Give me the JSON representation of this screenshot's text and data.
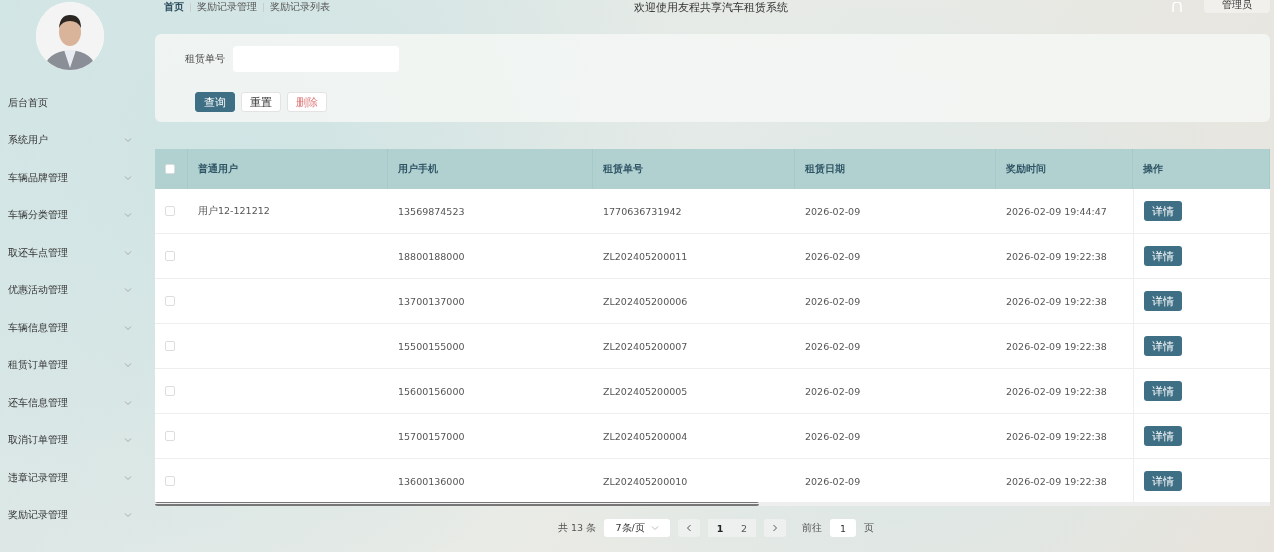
{
  "breadcrumb": [
    {
      "label": "首页",
      "selected": true
    },
    {
      "label": "奖励记录管理",
      "selected": false
    },
    {
      "label": "奖励记录列表",
      "selected": false
    }
  ],
  "header": {
    "title": "欢迎使用友程共享汽车租赁系统",
    "user_button": "管理员"
  },
  "sidebar": {
    "items": [
      {
        "label": "后台首页",
        "expandable": false
      },
      {
        "label": "系统用户",
        "expandable": true
      },
      {
        "label": "车辆品牌管理",
        "expandable": true
      },
      {
        "label": "车辆分类管理",
        "expandable": true
      },
      {
        "label": "取还车点管理",
        "expandable": true
      },
      {
        "label": "优惠活动管理",
        "expandable": true
      },
      {
        "label": "车辆信息管理",
        "expandable": true
      },
      {
        "label": "租赁订单管理",
        "expandable": true
      },
      {
        "label": "还车信息管理",
        "expandable": true
      },
      {
        "label": "取消订单管理",
        "expandable": true
      },
      {
        "label": "违章记录管理",
        "expandable": true
      },
      {
        "label": "奖励记录管理",
        "expandable": true
      }
    ]
  },
  "search": {
    "label": "租赁单号",
    "buttons": [
      {
        "label": "查询",
        "kind": "primary"
      },
      {
        "label": "重置",
        "kind": "default"
      },
      {
        "label": "删除",
        "kind": "danger"
      }
    ]
  },
  "table": {
    "select_all": {
      "checked": false
    },
    "columns": [
      "普通用户",
      "用户手机",
      "租赁单号",
      "租赁日期",
      "奖励时间",
      "操作"
    ],
    "rows": [
      {
        "checked": false,
        "cells": [
          "用户12-121212",
          "13569874523",
          "1770636731942",
          "2026-02-09",
          "2026-02-09 19:44:47"
        ],
        "action": "详情"
      },
      {
        "checked": false,
        "cells": [
          "",
          "18800188000",
          "ZL202405200011",
          "2026-02-09",
          "2026-02-09 19:22:38"
        ],
        "action": "详情"
      },
      {
        "checked": false,
        "cells": [
          "",
          "13700137000",
          "ZL202405200006",
          "2026-02-09",
          "2026-02-09 19:22:38"
        ],
        "action": "详情"
      },
      {
        "checked": false,
        "cells": [
          "",
          "15500155000",
          "ZL202405200007",
          "2026-02-09",
          "2026-02-09 19:22:38"
        ],
        "action": "详情"
      },
      {
        "checked": false,
        "cells": [
          "",
          "15600156000",
          "ZL202405200005",
          "2026-02-09",
          "2026-02-09 19:22:38"
        ],
        "action": "详情"
      },
      {
        "checked": false,
        "cells": [
          "",
          "15700157000",
          "ZL202405200004",
          "2026-02-09",
          "2026-02-09 19:22:38"
        ],
        "action": "详情"
      },
      {
        "checked": false,
        "cells": [
          "",
          "13600136000",
          "ZL202405200010",
          "2026-02-09",
          "2026-02-09 19:22:38"
        ],
        "action": "详情"
      }
    ]
  },
  "pagination": {
    "total": "共 13 条",
    "page_size": "7条/页",
    "pages": [
      {
        "label": "1",
        "selected": true
      },
      {
        "label": "2",
        "selected": false
      }
    ],
    "goto_label": "前往",
    "goto_value": "1",
    "goto_suffix": "页"
  }
}
